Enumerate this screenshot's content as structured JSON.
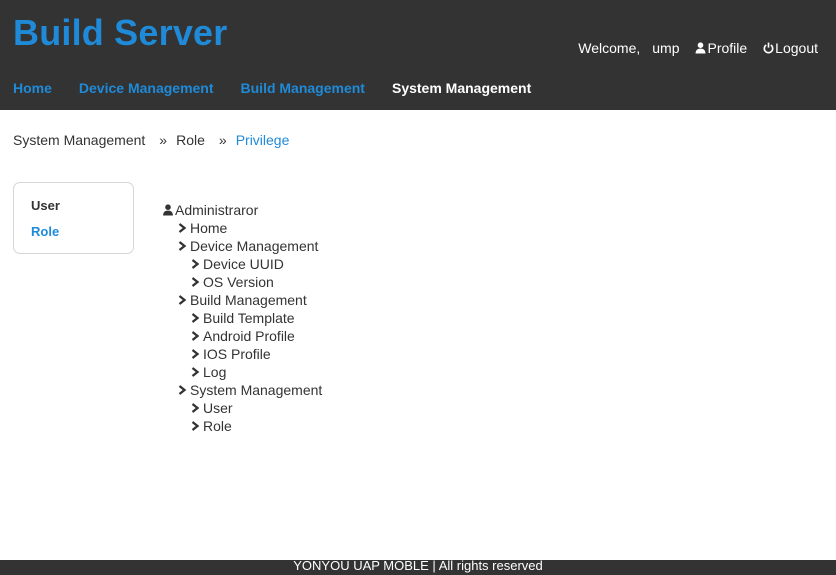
{
  "header": {
    "title": "Build Server",
    "welcome": "Welcome,",
    "username": "ump",
    "profile_label": "Profile",
    "logout_label": "Logout"
  },
  "nav": {
    "items": [
      {
        "label": "Home",
        "active": false
      },
      {
        "label": "Device Management",
        "active": false
      },
      {
        "label": "Build Management",
        "active": false
      },
      {
        "label": "System Management",
        "active": true
      }
    ]
  },
  "breadcrumb": {
    "items": [
      "System Management",
      "Role",
      "Privilege"
    ],
    "separator": "»"
  },
  "sidemenu": {
    "items": [
      "User",
      "Role"
    ],
    "active": "Role"
  },
  "privilege_tree": {
    "root": "Administraror",
    "nodes": [
      {
        "label": "Home",
        "level": 1
      },
      {
        "label": "Device Management",
        "level": 1
      },
      {
        "label": "Device UUID",
        "level": 2
      },
      {
        "label": "OS Version",
        "level": 2
      },
      {
        "label": "Build Management",
        "level": 1
      },
      {
        "label": "Build Template",
        "level": 2
      },
      {
        "label": "Android Profile",
        "level": 2
      },
      {
        "label": "IOS Profile",
        "level": 2
      },
      {
        "label": "Log",
        "level": 2
      },
      {
        "label": "System Management",
        "level": 1
      },
      {
        "label": "User",
        "level": 2
      },
      {
        "label": "Role",
        "level": 2
      }
    ]
  },
  "footer": {
    "text": "YONYOU UAP MOBLE | All rights reserved"
  },
  "colors": {
    "header_bg": "#333333",
    "accent": "#1f8ad8",
    "text": "#333333"
  },
  "icons": {
    "profile": "user-icon",
    "logout": "power-icon",
    "tree_root": "user-icon",
    "tree_node": "chevron-right-icon"
  }
}
